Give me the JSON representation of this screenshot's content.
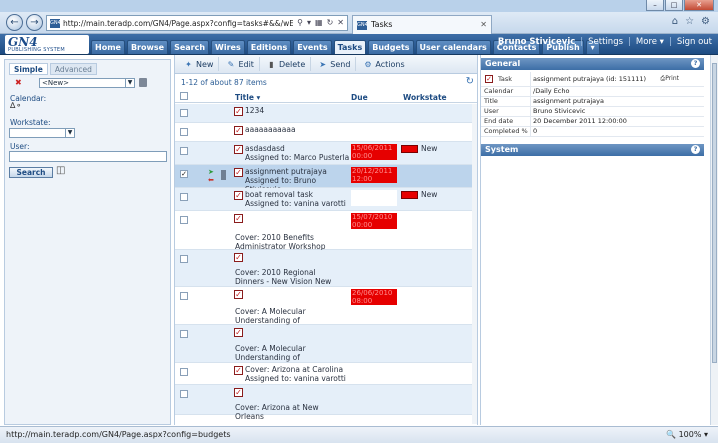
{
  "browser": {
    "url": "http://main.teradp.com/GN4/Page.aspx?config=tasks#&&/wEXBwUXd3A",
    "tab_title": "Tasks",
    "status_url": "http://main.teradp.com/GN4/Page.aspx?config=budgets",
    "zoom": "100%"
  },
  "app": {
    "logo_text": "GN4",
    "logo_sub": "PUBLISHING SYSTEM",
    "tabs": [
      "Home",
      "Browse",
      "Search",
      "Wires",
      "Editions",
      "Events",
      "Tasks",
      "Budgets",
      "User calendars",
      "Contacts",
      "Publish",
      "▾"
    ],
    "active_tab": "Tasks",
    "user": "Bruno Stivicevic",
    "settings": "Settings",
    "more": "More ▾",
    "signout": "Sign out"
  },
  "left": {
    "tab_simple": "Simple",
    "tab_advanced": "Advanced",
    "saved_search": "<New>",
    "calendar_label": "Calendar:",
    "workstate_label": "Workstate:",
    "user_label": "User:",
    "search_btn": "Search"
  },
  "toolbar": {
    "new": "New",
    "edit": "Edit",
    "delete": "Delete",
    "send": "Send",
    "actions": "Actions"
  },
  "list": {
    "count": "1-12 of about 87 items",
    "col_title": "Title ▾",
    "col_due": "Due",
    "col_workstate": "Workstate",
    "rows": [
      {
        "title": "1234",
        "due": "",
        "ws": ""
      },
      {
        "title": "aaaaaaaaaaa",
        "due": "",
        "ws": ""
      },
      {
        "title": "asdasdasd",
        "assigned": "Assigned to: Marco Pusterla",
        "due": "15/06/2011 00:00",
        "ws": "New"
      },
      {
        "title": "assignment putrajaya",
        "assigned": "Assigned to: Bruno Stivicevic",
        "due": "20/12/2011 12:00",
        "ws": ""
      },
      {
        "title": "boat removal task",
        "assigned": "Assigned to: vanina varotti",
        "due": "",
        "ws": "New"
      },
      {
        "title": "Cover: 2010 Benefits Administrator Workshop",
        "due": "15/07/2010 00:00",
        "ws": ""
      },
      {
        "title": "Cover: 2010 Regional Dinners - New Vision New Direction",
        "due": "",
        "ws": ""
      },
      {
        "title": "Cover: A Molecular Understanding of Epigenetics",
        "due": "26/06/2010 08:00",
        "ws": ""
      },
      {
        "title": "Cover: A Molecular Understanding of Epigenetics",
        "due": "",
        "ws": ""
      },
      {
        "title": "Cover: Arizona at Carolina",
        "assigned": "Assigned to: vanina varotti",
        "due": "",
        "ws": ""
      },
      {
        "title": "Cover: Arizona at New Orleans",
        "due": "",
        "ws": ""
      }
    ]
  },
  "details": {
    "general_title": "General",
    "system_title": "System",
    "help": "?",
    "print": "Print",
    "props": [
      {
        "k": "Task",
        "v": "assignment putrajaya (id: 151111)"
      },
      {
        "k": "Calendar",
        "v": "/Daily Echo"
      },
      {
        "k": "Title",
        "v": "assignment putrajaya"
      },
      {
        "k": "User",
        "v": "Bruno Stivicevic"
      },
      {
        "k": "End date",
        "v": "20 December 2011 12:00:00"
      },
      {
        "k": "Completed %",
        "v": "0"
      }
    ]
  },
  "colors": {
    "header": "#1d4b82",
    "due_red": "#e60000",
    "selected_row": "#bcd4ec"
  }
}
